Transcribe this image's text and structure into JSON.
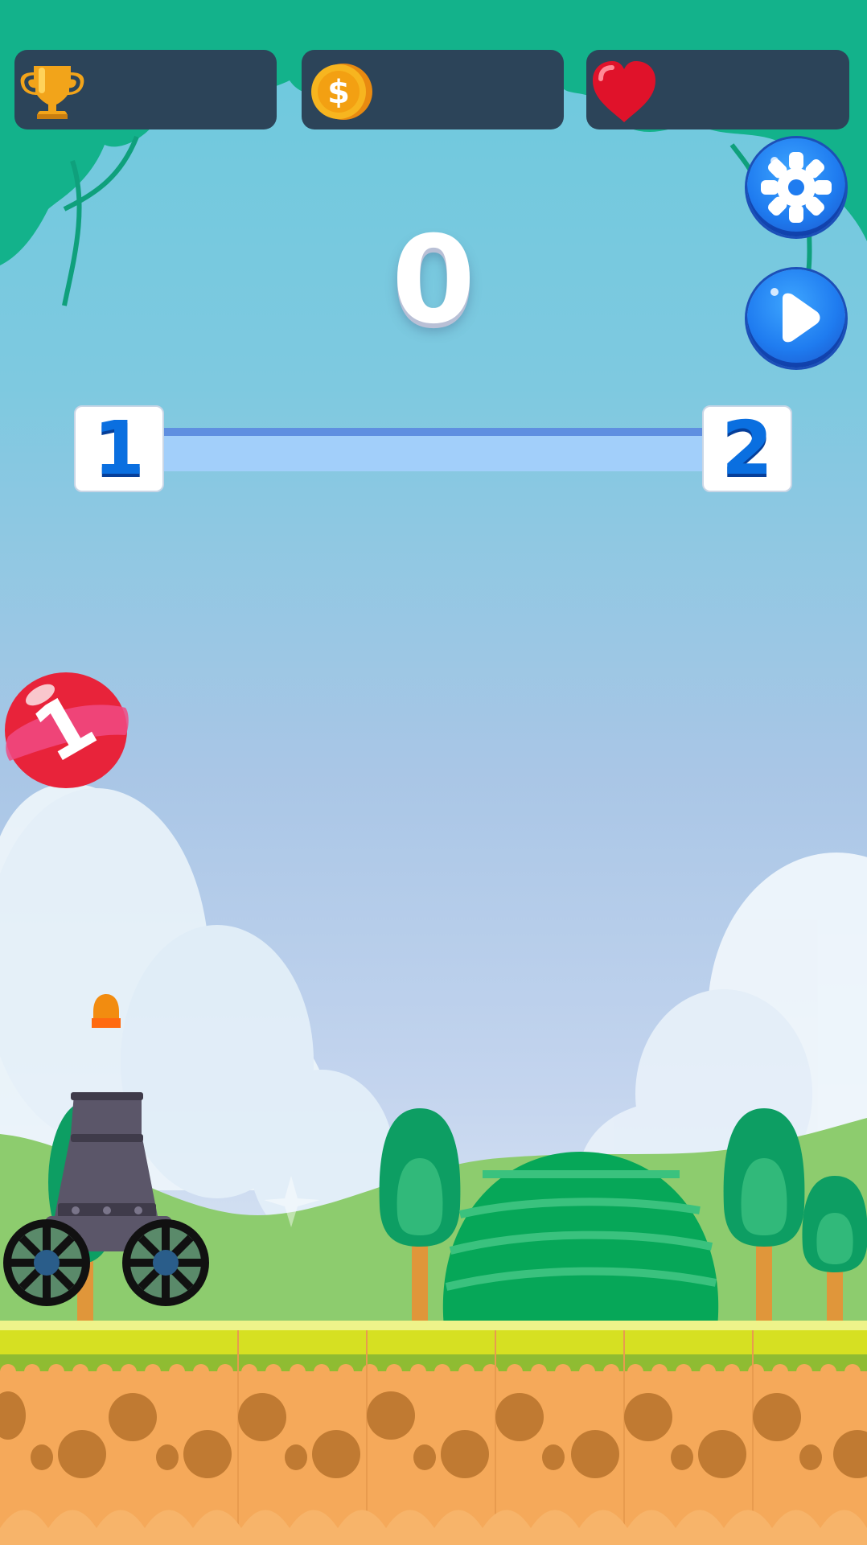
{
  "hud": {
    "trophy": {
      "icon": "trophy-icon",
      "value": ""
    },
    "coins": {
      "icon": "coin-icon",
      "value": ""
    },
    "lives": {
      "icon": "heart-icon",
      "value": ""
    }
  },
  "buttons": {
    "settings": {
      "icon": "gear-icon"
    },
    "play": {
      "icon": "play-icon"
    }
  },
  "score": "0",
  "level": {
    "current": "1",
    "next": "2",
    "progress": 0
  },
  "ball": {
    "label": "1",
    "color": "#e8233a"
  },
  "colors": {
    "sky_top": "#6cc9dd",
    "canopy": "#14b38c",
    "hud_panel": "#2c4459",
    "grass": "#d6e022",
    "dirt": "#f5a95a"
  }
}
